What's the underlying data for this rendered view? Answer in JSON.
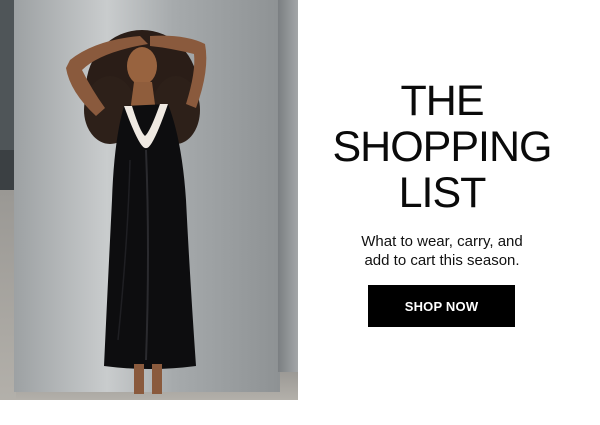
{
  "promo": {
    "headline_lines": [
      "THE",
      "SHOPPING",
      "LIST"
    ],
    "subtext_lines": [
      "What to wear, carry, and",
      "add to cart this season."
    ],
    "cta_label": "SHOP NOW"
  },
  "colors": {
    "background": "#ffffff",
    "text": "#0a0a0a",
    "button_bg": "#000000",
    "button_text": "#ffffff"
  },
  "image": {
    "subject": "model-in-black-slip-dress-against-metal-wall"
  }
}
